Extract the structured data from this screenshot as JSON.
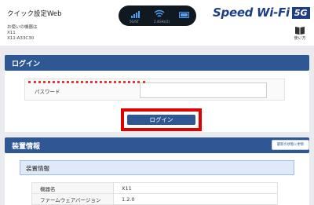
{
  "header": {
    "app_title": "クイック設定Web",
    "device_caption": "お使いの機器は",
    "device_model_1": "X11",
    "device_model_2": "X11-A33C30",
    "status": {
      "network_label": "5G/ST",
      "band_label": "2.4GHz(1)",
      "signal_icon": "signal-bars-icon",
      "wifi_icon": "wifi-icon",
      "battery_icon": "battery-icon",
      "accent_color": "#4aa3ff"
    },
    "brand_text": "Speed Wi-Fi",
    "brand_badge": "5G",
    "manual_label": "使い方"
  },
  "login_section": {
    "title": "ログイン",
    "password_label": "パスワード",
    "password_value": "",
    "login_button": "ログイン"
  },
  "device_section": {
    "title": "装置情報",
    "refresh_button": "最新の状態に更新",
    "subtitle": "装置情報",
    "rows": [
      {
        "key": "機器名",
        "value": "X11"
      },
      {
        "key": "ファームウェアバージョン",
        "value": "1.2.0"
      }
    ]
  },
  "colors": {
    "section_bar": "#2f5794",
    "highlight": "#e00000",
    "brand": "#1e3d87"
  }
}
